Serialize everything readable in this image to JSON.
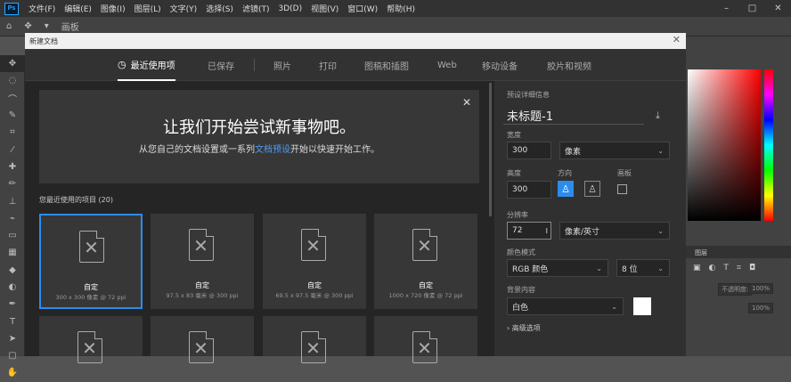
{
  "app": {
    "logo": "Ps"
  },
  "menu": [
    "文件(F)",
    "编辑(E)",
    "图像(I)",
    "图层(L)",
    "文字(Y)",
    "选择(S)",
    "滤镜(T)",
    "3D(D)",
    "视图(V)",
    "窗口(W)",
    "帮助(H)"
  ],
  "window_controls": [
    "–",
    "□",
    "✕"
  ],
  "options_bar": {
    "mode_label": "画板"
  },
  "tools": [
    "✥",
    "◌",
    "⌒",
    "✎",
    "⌗",
    "⁄",
    "✚",
    "✏",
    "⊥",
    "⌁",
    "▭",
    "▦",
    "◆",
    "◐",
    "✒",
    "T",
    "➤",
    "▢",
    "✋"
  ],
  "dialog": {
    "title": "新建文档",
    "close": "✕",
    "tabs": [
      "最近使用项",
      "已保存",
      "照片",
      "打印",
      "图稿和插图",
      "Web",
      "移动设备",
      "胶片和视频"
    ],
    "banner": {
      "title": "让我们开始尝试新事物吧。",
      "sub_before": "从您自己的文档设置或一系列",
      "sub_link": "文档预设",
      "sub_after": "开始以快速开始工作。",
      "close": "✕"
    },
    "recent_title": "您最近使用的项目 (20)",
    "cards": [
      {
        "name": "自定",
        "size": "300 x 300 像素 @ 72 ppi"
      },
      {
        "name": "自定",
        "size": "97.5 x 83 毫米 @ 300 ppi"
      },
      {
        "name": "自定",
        "size": "69.5 x 97.5 毫米 @ 300 ppi"
      },
      {
        "name": "自定",
        "size": "1000 x 720 像素 @ 72 ppi"
      }
    ],
    "details": {
      "header": "预设详细信息",
      "doc_name": "未标题-1",
      "width_label": "宽度",
      "width_value": "300",
      "width_unit": "像素",
      "height_label": "高度",
      "height_value": "300",
      "orientation_label": "方向",
      "artboard_label": "画板",
      "resolution_label": "分辨率",
      "resolution_value": "72",
      "resolution_unit": "像素/英寸",
      "color_mode_label": "颜色模式",
      "color_mode_value": "RGB 颜色",
      "bit_depth_value": "8 位",
      "background_label": "背景内容",
      "background_value": "白色",
      "advanced_label": "高级选项"
    }
  },
  "layers_panel": {
    "title": "图层",
    "opacity_label": "不透明度:",
    "opacity_value": "100%",
    "fill_value": "100%"
  },
  "colors": {
    "accent": "#2d8ceb",
    "link": "#4e9cf5"
  }
}
